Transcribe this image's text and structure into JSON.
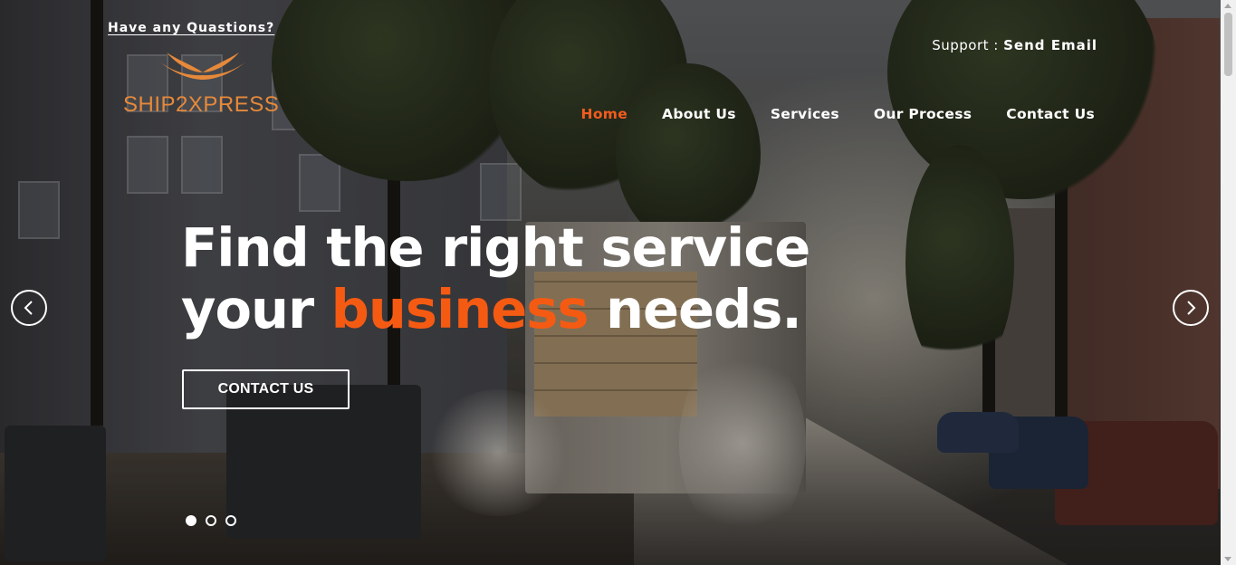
{
  "topbar": {
    "question_link": "Have any Quastions?",
    "support_label": "Support : ",
    "support_link": "Send Email"
  },
  "logo": {
    "text": "SHIP2XPRESS",
    "color": "#e6893a"
  },
  "nav": {
    "items": [
      {
        "label": "Home",
        "active": true
      },
      {
        "label": "About Us"
      },
      {
        "label": "Services"
      },
      {
        "label": "Our Process"
      },
      {
        "label": "Contact Us"
      }
    ],
    "active_color": "#f25c1e"
  },
  "hero": {
    "headline_line1": "Find the right service",
    "headline_line2_start": "your ",
    "headline_accent": "business",
    "headline_line2_end": " needs.",
    "accent_color": "#f55a13",
    "cta_label": "CONTACT US",
    "slides_total": 3,
    "active_slide": 1,
    "prev_icon": "chevron-left-icon",
    "next_icon": "chevron-right-icon"
  }
}
